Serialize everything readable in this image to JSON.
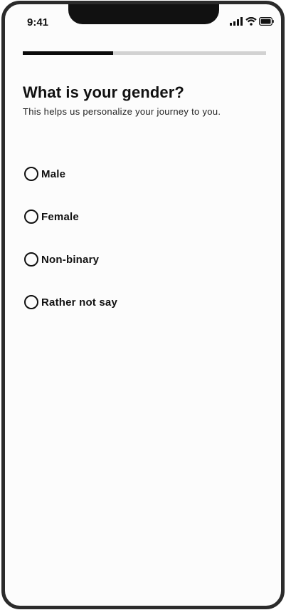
{
  "status_bar": {
    "time": "9:41",
    "icons": [
      "cellular-signal-icon",
      "wifi-icon",
      "battery-icon"
    ]
  },
  "progress": {
    "fraction": 0.37
  },
  "question": {
    "title": "What is your gender?",
    "subtitle": "This helps us personalize your journey to you."
  },
  "options": [
    {
      "label": "Male"
    },
    {
      "label": "Female"
    },
    {
      "label": "Non-binary"
    },
    {
      "label": "Rather not say"
    }
  ],
  "colors": {
    "frame": "#2b2b2b",
    "background": "#fcfcfc",
    "progress_fill": "#0b0b0b",
    "progress_track": "#d2d2d2",
    "text": "#111111"
  }
}
